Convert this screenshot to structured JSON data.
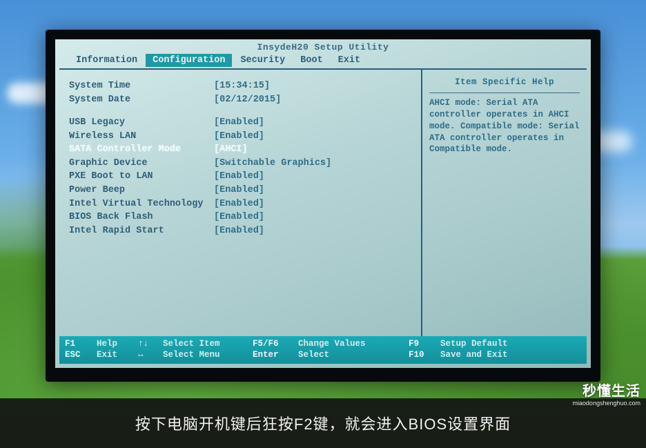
{
  "bios": {
    "utility_title": "InsydeH20 Setup Utility",
    "menu": {
      "information": "Information",
      "configuration": "Configuration",
      "security": "Security",
      "boot": "Boot",
      "exit": "Exit"
    },
    "settings": [
      {
        "label": "System Time",
        "value": "[15:34:15]",
        "interact": true
      },
      {
        "label": "System Date",
        "value": "[02/12/2015]",
        "interact": true
      }
    ],
    "settings2": [
      {
        "label": "USB Legacy",
        "value": "[Enabled]",
        "interact": true
      },
      {
        "label": "Wireless LAN",
        "value": "[Enabled]",
        "interact": true
      },
      {
        "label": "SATA Controller Mode",
        "value": "[AHCI]",
        "interact": true,
        "selected": true
      },
      {
        "label": "Graphic Device",
        "value": "[Switchable Graphics]",
        "interact": true
      },
      {
        "label": "PXE Boot to LAN",
        "value": "[Enabled]",
        "interact": true
      },
      {
        "label": "Power Beep",
        "value": "[Enabled]",
        "interact": true
      },
      {
        "label": "Intel Virtual Technology",
        "value": "[Enabled]",
        "interact": true
      },
      {
        "label": "BIOS Back Flash",
        "value": "[Enabled]",
        "interact": true
      },
      {
        "label": "Intel Rapid Start",
        "value": "[Enabled]",
        "interact": true
      }
    ],
    "help": {
      "title": "Item Specific Help",
      "body": "AHCI mode: Serial ATA controller operates in AHCI mode. Compatible mode: Serial ATA controller operates in Compatible mode."
    },
    "footer": {
      "f1": "F1",
      "f1d": "Help",
      "updown": "↑↓",
      "updownd": "Select Item",
      "f5f6": "F5/F6",
      "f5f6d": "Change Values",
      "f9": "F9",
      "f9d": "Setup Default",
      "esc": "ESC",
      "escd": "Exit",
      "lr": "↔",
      "lrd": "Select Menu",
      "enter": "Enter",
      "enterd": "Select",
      "f10": "F10",
      "f10d": "Save and Exit"
    }
  },
  "caption": "按下电脑开机键后狂按F2键，就会进入BIOS设置界面",
  "watermark": {
    "big": "秒懂生活",
    "small": "miaodongshenghuo.com"
  }
}
